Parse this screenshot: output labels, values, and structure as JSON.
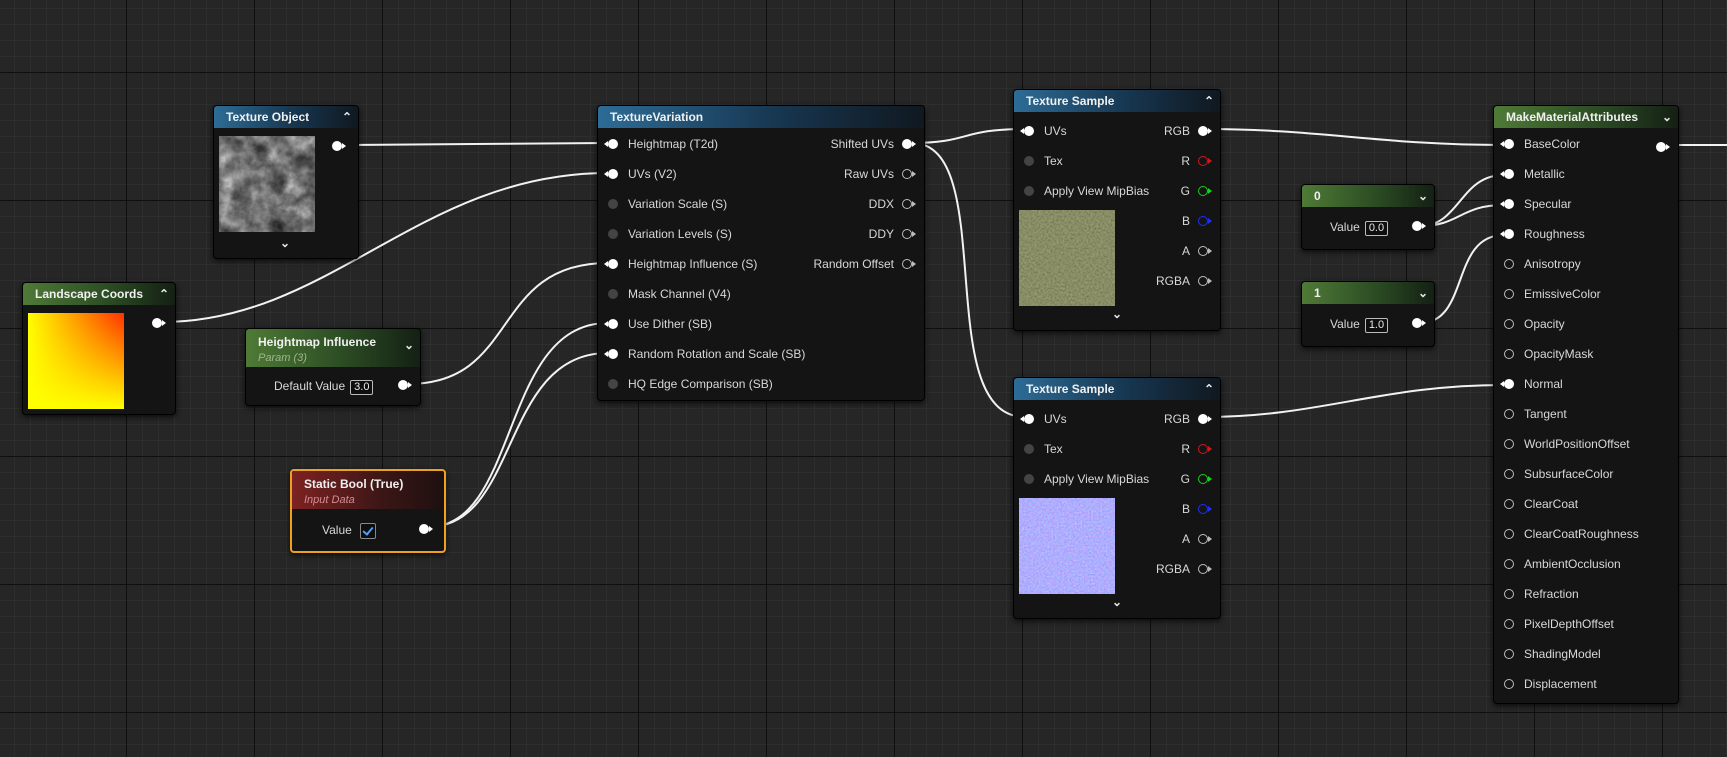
{
  "colors": {
    "blue_header": "#2d6c96",
    "green_header": "#4f7a36",
    "red_header": "#7d2222",
    "selection": "#f0a020",
    "wire": "#ffffff"
  },
  "nodes": {
    "texture_object": {
      "title": "Texture Object"
    },
    "landscape_coords": {
      "title": "Landscape Coords"
    },
    "heightmap_influence": {
      "title": "Heightmap Influence",
      "subtitle": "Param (3)",
      "field_label": "Default Value",
      "field_value": "3.0"
    },
    "static_bool": {
      "title": "Static Bool (True)",
      "subtitle": "Input Data",
      "field_label": "Value",
      "checked": true
    },
    "texture_variation": {
      "title": "TextureVariation",
      "inputs": [
        "Heightmap (T2d)",
        "UVs (V2)",
        "Variation Scale (S)",
        "Variation Levels (S)",
        "Heightmap Influence (S)",
        "Mask Channel (V4)",
        "Use Dither (SB)",
        "Random Rotation and Scale (SB)",
        "HQ Edge Comparison (SB)"
      ],
      "outputs": [
        "Shifted UVs",
        "Raw UVs",
        "DDX",
        "DDY",
        "Random Offset"
      ]
    },
    "texture_sample_1": {
      "title": "Texture Sample",
      "inputs": [
        "UVs",
        "Tex",
        "Apply View MipBias"
      ],
      "outputs": [
        "RGB",
        "R",
        "G",
        "B",
        "A",
        "RGBA"
      ]
    },
    "texture_sample_2": {
      "title": "Texture Sample",
      "inputs": [
        "UVs",
        "Tex",
        "Apply View MipBias"
      ],
      "outputs": [
        "RGB",
        "R",
        "G",
        "B",
        "A",
        "RGBA"
      ]
    },
    "constant_0": {
      "title": "0",
      "field_label": "Value",
      "field_value": "0.0"
    },
    "constant_1": {
      "title": "1",
      "field_label": "Value",
      "field_value": "1.0"
    },
    "make_material_attributes": {
      "title": "MakeMaterialAttributes",
      "inputs": [
        "BaseColor",
        "Metallic",
        "Specular",
        "Roughness",
        "Anisotropy",
        "EmissiveColor",
        "Opacity",
        "OpacityMask",
        "Normal",
        "Tangent",
        "WorldPositionOffset",
        "SubsurfaceColor",
        "ClearCoat",
        "ClearCoatRoughness",
        "AmbientOcclusion",
        "Refraction",
        "PixelDepthOffset",
        "ShadingModel",
        "Displacement"
      ]
    }
  }
}
